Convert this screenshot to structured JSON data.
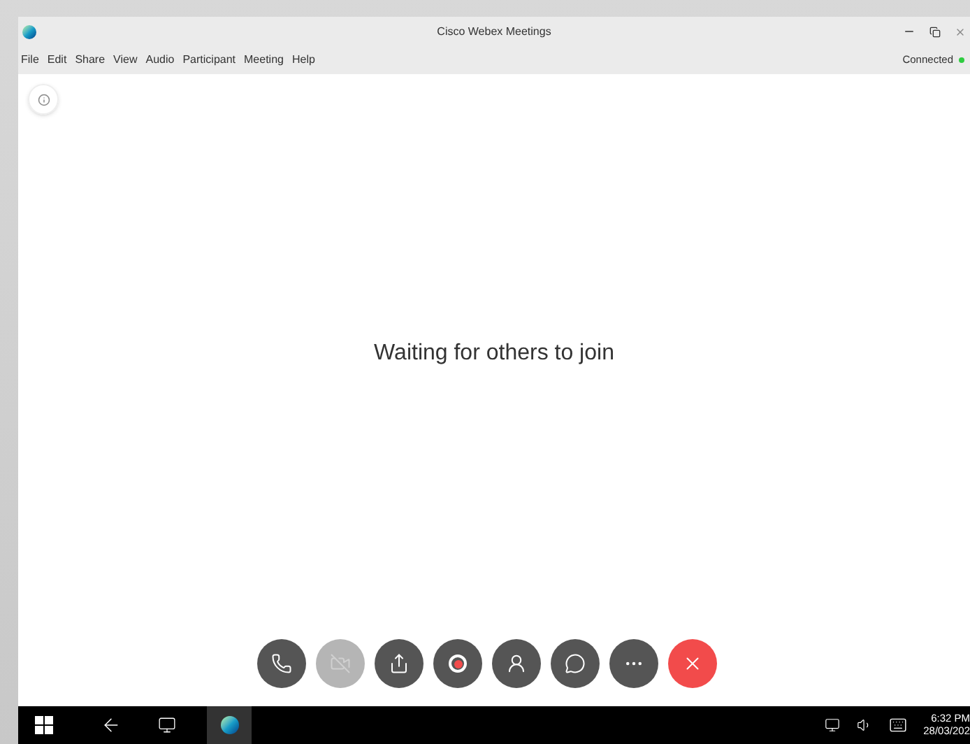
{
  "window": {
    "title": "Cisco Webex Meetings"
  },
  "menu": [
    "File",
    "Edit",
    "Share",
    "View",
    "Audio",
    "Participant",
    "Meeting",
    "Help"
  ],
  "status": {
    "label": "Connected",
    "color": "#2ecc40"
  },
  "message": "Waiting for others to join",
  "controls": [
    {
      "kind": "audio",
      "disabled": false
    },
    {
      "kind": "video",
      "disabled": true
    },
    {
      "kind": "share",
      "disabled": false
    },
    {
      "kind": "record",
      "disabled": false
    },
    {
      "kind": "participants",
      "disabled": false
    },
    {
      "kind": "chat",
      "disabled": false
    },
    {
      "kind": "more",
      "disabled": false
    },
    {
      "kind": "leave",
      "disabled": false
    }
  ],
  "taskbar": {
    "time": "6:32 PM",
    "date": "28/03/202"
  }
}
